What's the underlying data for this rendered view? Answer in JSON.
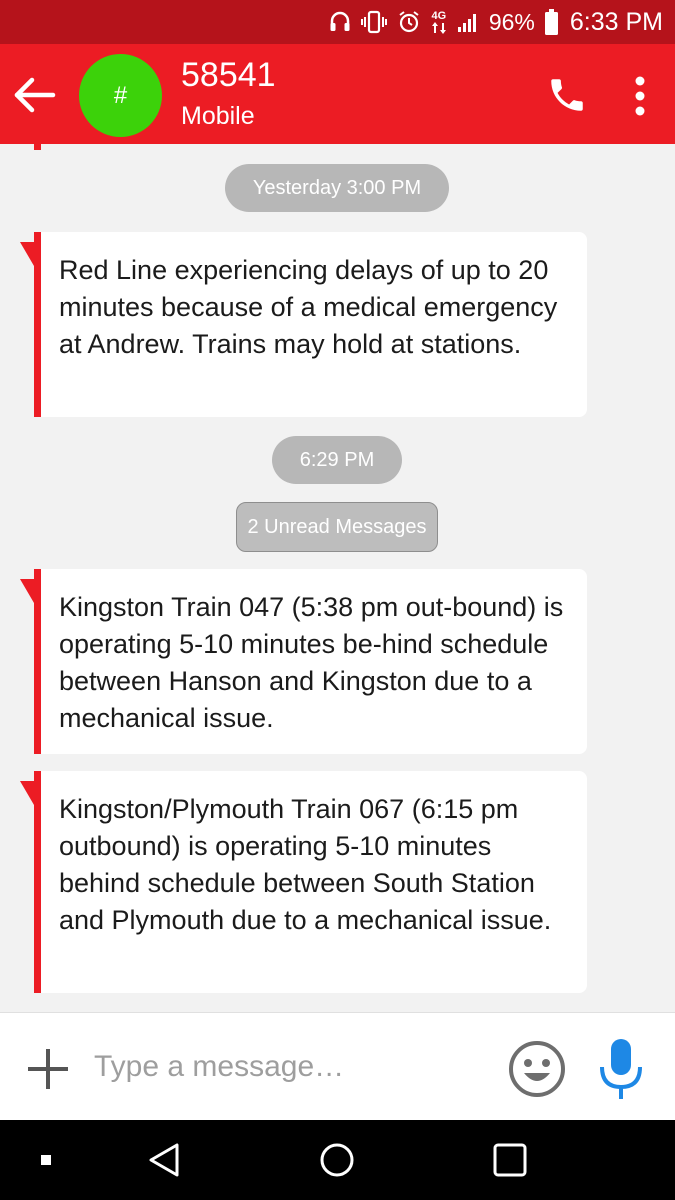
{
  "status_bar": {
    "network_label": "4G",
    "battery_percent": "96%",
    "time": "6:33 PM",
    "icons": [
      "headset-icon",
      "vibrate-icon",
      "alarm-icon",
      "data-arrows-icon",
      "signal-icon",
      "battery-icon"
    ]
  },
  "header": {
    "avatar_initial": "#",
    "contact_name": "58541",
    "contact_type": "Mobile",
    "icons": [
      "back-arrow-icon",
      "phone-icon",
      "more-vert-icon"
    ]
  },
  "conversation": {
    "items": [
      {
        "kind": "timestamp",
        "text": "Yesterday 3:00 PM"
      },
      {
        "kind": "message",
        "text": "Red Line experiencing delays of up to 20 minutes because of a medical emergency at Andrew. Trains may hold at stations."
      },
      {
        "kind": "timestamp",
        "text": "6:29 PM"
      },
      {
        "kind": "unread_divider",
        "text": "2 Unread Messages"
      },
      {
        "kind": "message",
        "text": "Kingston Train 047 (5:38 pm out-bound) is operating 5-10 minutes be-hind schedule between Hanson and Kingston due to a mechanical issue."
      },
      {
        "kind": "message",
        "text": "Kingston/Plymouth Train 067 (6:15 pm outbound) is operating 5-10 minutes behind schedule between South Station and Plymouth due to a mechanical issue."
      }
    ]
  },
  "composer": {
    "placeholder": "Type a message…",
    "value": "",
    "icons": [
      "add-icon",
      "emoji-icon",
      "microphone-icon"
    ]
  },
  "nav_bar": {
    "icons": [
      "recents-square-small-icon",
      "back-triangle-icon",
      "home-circle-icon",
      "overview-square-icon"
    ]
  },
  "colors": {
    "status_bar_bg": "#b5131b",
    "app_bar_bg": "#ec1c24",
    "avatar_bg": "#3cd20a",
    "message_accent": "#ec1c24",
    "pill_bg": "#b7b7b7",
    "mic_blue": "#1e88e5"
  }
}
